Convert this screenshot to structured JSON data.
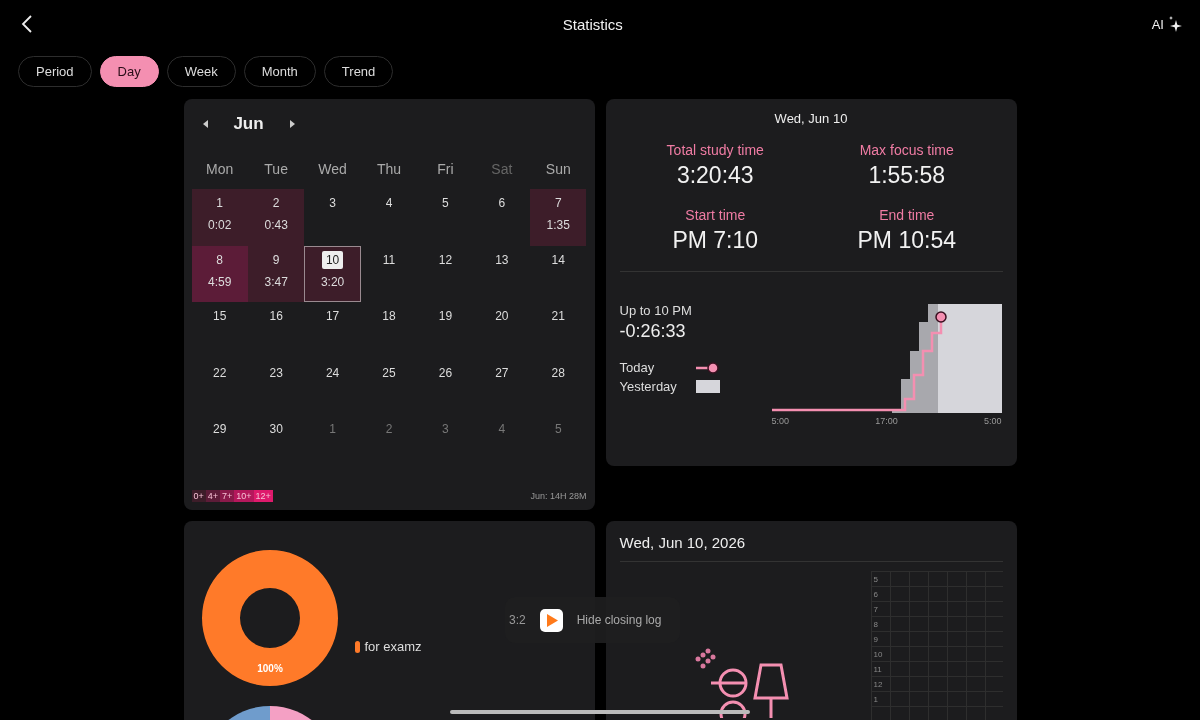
{
  "header": {
    "title": "Statistics",
    "ai_label": "AI"
  },
  "tabs": [
    {
      "label": "Period",
      "selected": false
    },
    {
      "label": "Day",
      "selected": true
    },
    {
      "label": "Week",
      "selected": false
    },
    {
      "label": "Month",
      "selected": false
    },
    {
      "label": "Trend",
      "selected": false
    }
  ],
  "calendar": {
    "month": "Jun",
    "weekdays": [
      {
        "label": "Mon",
        "dim": false
      },
      {
        "label": "Tue",
        "dim": false
      },
      {
        "label": "Wed",
        "dim": false
      },
      {
        "label": "Thu",
        "dim": false
      },
      {
        "label": "Fri",
        "dim": false
      },
      {
        "label": "Sat",
        "dim": true
      },
      {
        "label": "Sun",
        "dim": false
      }
    ],
    "weeks": [
      {
        "days": [
          {
            "day": "1",
            "time": "0:02",
            "color": "#3d1d29",
            "outside": false,
            "selected": false
          },
          {
            "day": "2",
            "time": "0:43",
            "color": "#3d1d29",
            "outside": false,
            "selected": false
          },
          {
            "day": "3",
            "outside": false,
            "selected": false
          },
          {
            "day": "4",
            "outside": false,
            "selected": false
          },
          {
            "day": "5",
            "outside": false,
            "selected": false
          },
          {
            "day": "6",
            "outside": false,
            "selected": false
          },
          {
            "day": "7",
            "time": "1:35",
            "color": "#3d1d29",
            "outside": false,
            "selected": false
          }
        ]
      },
      {
        "days": [
          {
            "day": "8",
            "time": "4:59",
            "color": "#5c1c38",
            "outside": false,
            "selected": false
          },
          {
            "day": "9",
            "time": "3:47",
            "color": "#3d1d29",
            "outside": false,
            "selected": false
          },
          {
            "day": "10",
            "time": "3:20",
            "color": "#3d1d29",
            "outside": false,
            "selected": true
          },
          {
            "day": "11",
            "outside": false,
            "selected": false
          },
          {
            "day": "12",
            "outside": false,
            "selected": false
          },
          {
            "day": "13",
            "outside": false,
            "selected": false
          },
          {
            "day": "14",
            "outside": false,
            "selected": false
          }
        ]
      },
      {
        "days": [
          {
            "day": "15",
            "outside": false,
            "selected": false
          },
          {
            "day": "16",
            "outside": false,
            "selected": false
          },
          {
            "day": "17",
            "outside": false,
            "selected": false
          },
          {
            "day": "18",
            "outside": false,
            "selected": false
          },
          {
            "day": "19",
            "outside": false,
            "selected": false
          },
          {
            "day": "20",
            "outside": false,
            "selected": false
          },
          {
            "day": "21",
            "outside": false,
            "selected": false
          }
        ]
      },
      {
        "days": [
          {
            "day": "22",
            "outside": false,
            "selected": false
          },
          {
            "day": "23",
            "outside": false,
            "selected": false
          },
          {
            "day": "24",
            "outside": false,
            "selected": false
          },
          {
            "day": "25",
            "outside": false,
            "selected": false
          },
          {
            "day": "26",
            "outside": false,
            "selected": false
          },
          {
            "day": "27",
            "outside": false,
            "selected": false
          },
          {
            "day": "28",
            "outside": false,
            "selected": false
          }
        ]
      },
      {
        "days": [
          {
            "day": "29",
            "outside": false,
            "selected": false
          },
          {
            "day": "30",
            "outside": false,
            "selected": false
          },
          {
            "day": "1",
            "outside": true,
            "selected": false
          },
          {
            "day": "2",
            "outside": true,
            "selected": false
          },
          {
            "day": "3",
            "outside": true,
            "selected": false
          },
          {
            "day": "4",
            "outside": true,
            "selected": false
          },
          {
            "day": "5",
            "outside": true,
            "selected": false
          }
        ]
      }
    ],
    "legend": [
      {
        "label": "0+",
        "color": "#3d1d29"
      },
      {
        "label": "4+",
        "color": "#5c1c38"
      },
      {
        "label": "7+",
        "color": "#8a1a4a"
      },
      {
        "label": "10+",
        "color": "#b5185c"
      },
      {
        "label": "12+",
        "color": "#de1a6c"
      }
    ],
    "total": "Jun: 14H 28M"
  },
  "day_summary": {
    "date": "Wed, Jun 10",
    "stats": [
      {
        "label": "Total study time",
        "value": "3:20:43"
      },
      {
        "label": "Max focus time",
        "value": "1:55:58"
      },
      {
        "label": "Start time",
        "value": "PM 7:10"
      },
      {
        "label": "End time",
        "value": "PM 10:54"
      }
    ],
    "compare_label": "Up to 10 PM",
    "compare_value": "-0:26:33",
    "legend": [
      {
        "label": "Today",
        "kind": "line"
      },
      {
        "label": "Yesterday",
        "kind": "area"
      }
    ],
    "x_labels": [
      "5:00",
      "17:00",
      "5:00"
    ]
  },
  "subjects": {
    "share_label": "100%",
    "legend": [
      {
        "label": "for examz",
        "color": "#ff7a29"
      }
    ]
  },
  "toast": {
    "time": "3:2",
    "text": "Hide closing log"
  },
  "timeline": {
    "date": "Wed, Jun 10, 2026",
    "hours": [
      "5",
      "6",
      "7",
      "8",
      "9",
      "10",
      "11",
      "12",
      "1"
    ]
  }
}
